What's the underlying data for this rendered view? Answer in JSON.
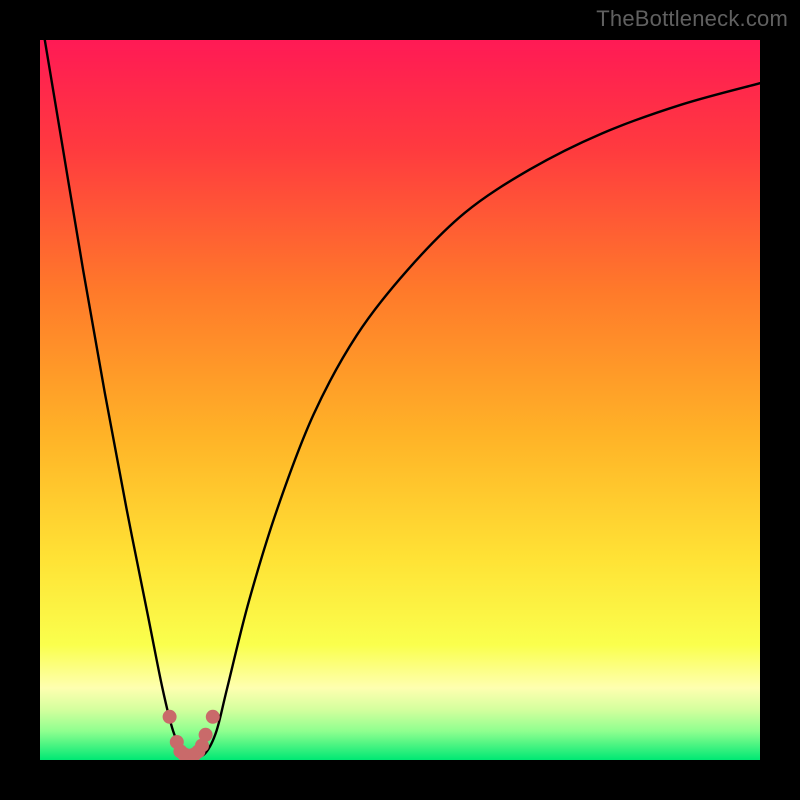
{
  "watermark": "TheBottleneck.com",
  "chart_data": {
    "type": "line",
    "title": "",
    "xlabel": "",
    "ylabel": "",
    "xlim": [
      0,
      100
    ],
    "ylim": [
      0,
      100
    ],
    "series": [
      {
        "name": "curve",
        "x": [
          0,
          3,
          6,
          9,
          12,
          15,
          17,
          18.5,
          20,
          21.5,
          23,
          24.5,
          26,
          29,
          33,
          38,
          44,
          51,
          59,
          68,
          78,
          89,
          100
        ],
        "y": [
          104,
          86,
          68,
          51,
          35,
          20,
          10,
          4,
          1,
          0.5,
          1,
          4,
          10,
          22,
          35,
          48,
          59,
          68,
          76,
          82,
          87,
          91,
          94
        ]
      }
    ],
    "markers": {
      "name": "dots",
      "x": [
        18.0,
        19.0,
        19.5,
        20.0,
        20.5,
        21.0,
        21.5,
        22.0,
        22.5,
        23.0,
        24.0
      ],
      "y": [
        6.0,
        2.5,
        1.2,
        0.8,
        0.6,
        0.6,
        0.8,
        1.2,
        2.0,
        3.5,
        6.0
      ]
    },
    "background_gradient": {
      "stops": [
        {
          "offset": 0.0,
          "color": "#ff1a55"
        },
        {
          "offset": 0.15,
          "color": "#ff3a3f"
        },
        {
          "offset": 0.35,
          "color": "#ff7a2a"
        },
        {
          "offset": 0.55,
          "color": "#ffb327"
        },
        {
          "offset": 0.72,
          "color": "#ffe235"
        },
        {
          "offset": 0.84,
          "color": "#faff4d"
        },
        {
          "offset": 0.9,
          "color": "#feffb0"
        },
        {
          "offset": 0.93,
          "color": "#d4ff9e"
        },
        {
          "offset": 0.96,
          "color": "#8fff8f"
        },
        {
          "offset": 1.0,
          "color": "#00e874"
        }
      ]
    },
    "colors": {
      "curve": "#000000",
      "markers": "#c96a6a",
      "frame": "#000000"
    }
  }
}
